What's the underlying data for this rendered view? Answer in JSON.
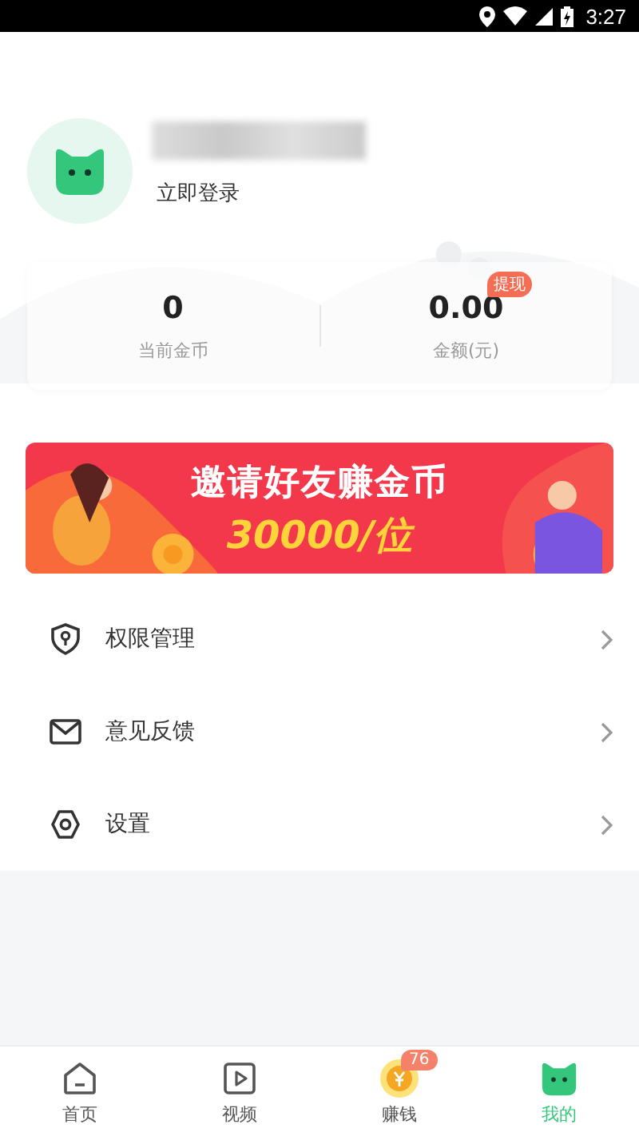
{
  "status_bar": {
    "time": "3:27"
  },
  "profile": {
    "login_label": "立即登录"
  },
  "stats": [
    {
      "value": "0",
      "label": "当前金币"
    },
    {
      "value": "0.00",
      "label": "金额(元)",
      "badge": "提现"
    }
  ],
  "banner": {
    "kind": "picture",
    "title": "邀请好友赚金币",
    "amount": "30000/位"
  },
  "menu": [
    {
      "kind": "permission",
      "label": "权限管理"
    },
    {
      "kind": "feedback",
      "label": "意见反馈"
    },
    {
      "kind": "settings",
      "label": "设置"
    }
  ],
  "tabs": [
    {
      "kind": "home",
      "label": "首页",
      "selected": false
    },
    {
      "kind": "video",
      "label": "视频",
      "selected": false
    },
    {
      "kind": "earn",
      "label": "赚钱",
      "selected": false,
      "badge": "76"
    },
    {
      "kind": "mine",
      "label": "我的",
      "selected": true
    }
  ]
}
